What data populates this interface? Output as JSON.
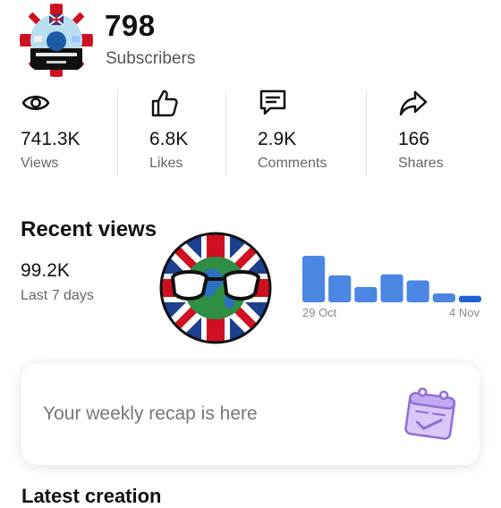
{
  "header": {
    "subscribers_count": "798",
    "subscribers_label": "Subscribers"
  },
  "stats": [
    {
      "icon": "eye-icon",
      "value": "741.3K",
      "label": "Views"
    },
    {
      "icon": "thumbs-up-icon",
      "value": "6.8K",
      "label": "Likes"
    },
    {
      "icon": "comment-icon",
      "value": "2.9K",
      "label": "Comments"
    },
    {
      "icon": "share-icon",
      "value": "166",
      "label": "Shares"
    }
  ],
  "recent_views": {
    "title": "Recent views",
    "value": "99.2K",
    "period": "Last 7 days",
    "chart": {
      "bar_levels": [
        1.0,
        0.58,
        0.33,
        0.6,
        0.47,
        0.19,
        0.14
      ],
      "highlight_index": 6,
      "bar_color": "#4a86e2",
      "highlight_color": "#1f63d6",
      "date_start": "29 Oct",
      "date_end": "4 Nov"
    }
  },
  "recap_card": {
    "text": "Your weekly recap is here",
    "icon": "calendar-check-icon",
    "icon_color": "#c9b4f2"
  },
  "latest": {
    "title": "Latest creation"
  },
  "colors": {
    "accent": "#4a86e2"
  }
}
